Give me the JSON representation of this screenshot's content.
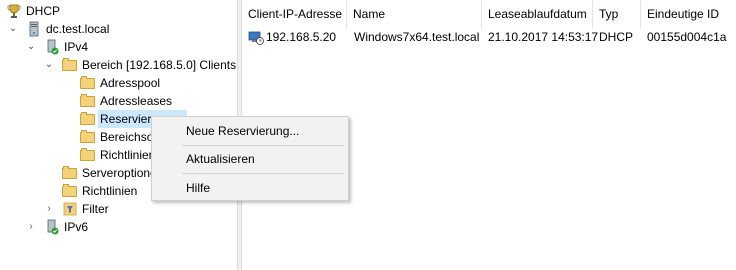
{
  "tree": {
    "root": {
      "label": "DHCP",
      "icon": "dhcp-trophy-icon"
    },
    "server": {
      "label": "dc.test.local",
      "icon": "server-icon"
    },
    "ipv4": {
      "label": "IPv4",
      "icon": "ipv4-icon"
    },
    "scope": {
      "label": "Bereich [192.168.5.0] Clients",
      "icon": "folder-icon"
    },
    "children": [
      {
        "label": "Adresspool",
        "icon": "folder-pool-icon"
      },
      {
        "label": "Adressleases",
        "icon": "folder-leases-icon"
      },
      {
        "label": "Reservierungen",
        "icon": "folder-reservations-icon"
      },
      {
        "label": "Bereichsoptionen",
        "icon": "folder-options-icon"
      },
      {
        "label": "Richtlinien",
        "icon": "folder-policies-icon"
      }
    ],
    "server_options": {
      "label": "Serveroptionen",
      "icon": "folder-options-icon"
    },
    "policies": {
      "label": "Richtlinien",
      "icon": "folder-policies-icon"
    },
    "filter": {
      "label": "Filter",
      "icon": "filter-icon"
    },
    "ipv6": {
      "label": "IPv6",
      "icon": "ipv6-icon"
    }
  },
  "list": {
    "columns": [
      "Client-IP-Adresse",
      "Name",
      "Leaseablaufdatum",
      "Typ",
      "Eindeutige ID"
    ],
    "rows": [
      [
        "192.168.5.20",
        "Windows7x64.test.local",
        "21.10.2017 14:53:17",
        "DHCP",
        "00155d004c1a"
      ]
    ]
  },
  "context_menu": {
    "items": [
      "Neue Reservierung...",
      "Aktualisieren",
      "Hilfe"
    ]
  }
}
